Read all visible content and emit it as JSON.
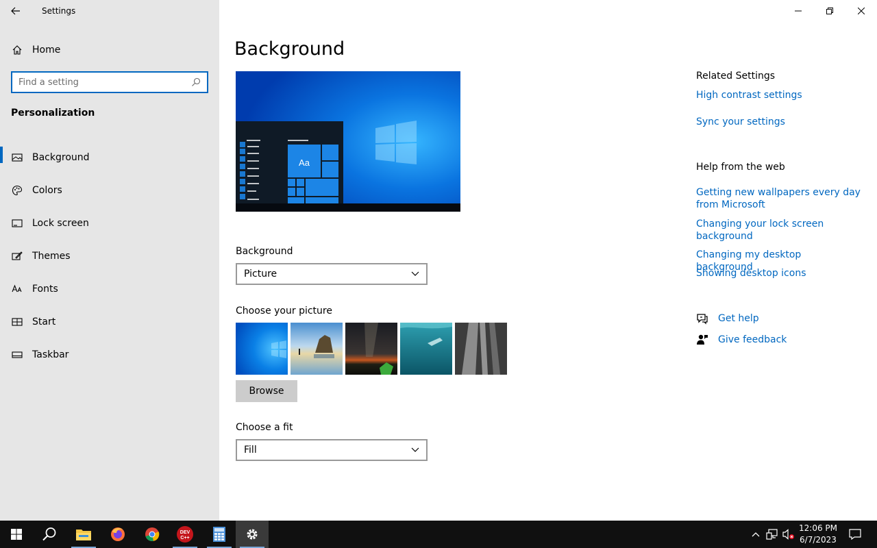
{
  "app": {
    "title": "Settings"
  },
  "sidebar": {
    "home_label": "Home",
    "search_placeholder": "Find a setting",
    "section_title": "Personalization",
    "items": [
      {
        "label": "Background",
        "icon": "picture-icon",
        "selected": true
      },
      {
        "label": "Colors",
        "icon": "palette-icon"
      },
      {
        "label": "Lock screen",
        "icon": "lock-screen-icon"
      },
      {
        "label": "Themes",
        "icon": "themes-icon"
      },
      {
        "label": "Fonts",
        "icon": "fonts-icon"
      },
      {
        "label": "Start",
        "icon": "start-icon"
      },
      {
        "label": "Taskbar",
        "icon": "taskbar-icon"
      }
    ]
  },
  "main": {
    "title": "Background",
    "preview_sample_text": "Aa",
    "background_label": "Background",
    "background_value": "Picture",
    "choose_picture_label": "Choose your picture",
    "browse_label": "Browse",
    "choose_fit_label": "Choose a fit",
    "fit_value": "Fill"
  },
  "related": {
    "heading": "Related Settings",
    "links": [
      "High contrast settings",
      "Sync your settings"
    ],
    "web_heading": "Help from the web",
    "web_links": [
      "Getting new wallpapers every day from Microsoft",
      "Changing your lock screen background",
      "Changing my desktop background",
      "Showing desktop icons"
    ],
    "get_help": "Get help",
    "give_feedback": "Give feedback"
  },
  "taskbar": {
    "apps": [
      "start-icon",
      "search-icon",
      "file-explorer-icon",
      "firefox-icon",
      "chrome-icon",
      "dev-cpp-icon",
      "calculator-icon",
      "settings-icon"
    ],
    "devcpp_label": "DEV C++",
    "time": "12:06 PM",
    "date": "6/7/2023"
  },
  "colors": {
    "accent": "#0067c0",
    "sidebar_bg": "#e6e6e6",
    "taskbar_bg": "#101010"
  }
}
